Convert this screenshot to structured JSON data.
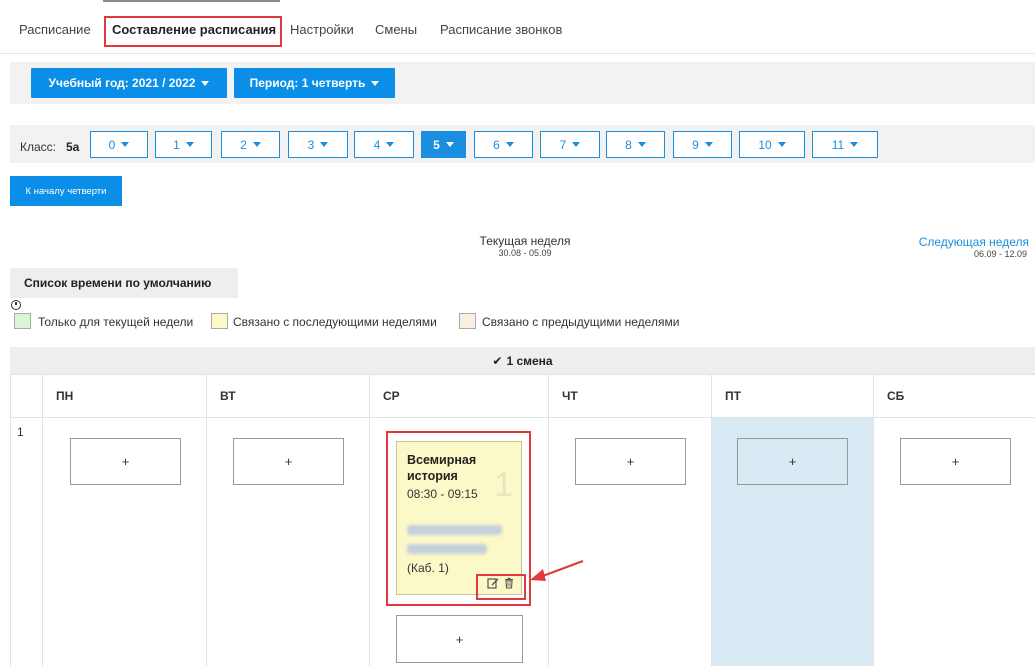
{
  "tabs": [
    {
      "label": "Расписание"
    },
    {
      "label": "Составление расписания",
      "active": true
    },
    {
      "label": "Настройки"
    },
    {
      "label": "Смены"
    },
    {
      "label": "Расписание звонков"
    }
  ],
  "filters": {
    "year_label": "Учебный год: 2021 / 2022",
    "period_label": "Период: 1 четверть"
  },
  "class_selector": {
    "label": "Класс:",
    "current": "5а",
    "grades": [
      "0",
      "1",
      "2",
      "3",
      "4",
      "5",
      "6",
      "7",
      "8",
      "9",
      "10",
      "11"
    ],
    "active_grade": "5"
  },
  "to_quarter_start": "К началу четверти",
  "week": {
    "current_label": "Текущая неделя",
    "current_dates": "30.08 - 05.09",
    "next_label": "Следующая неделя",
    "next_dates": "06.09 - 12.09"
  },
  "default_time_button": "Список времени по умолчанию",
  "legend": [
    {
      "label": "Только для текущей недели",
      "color": "#d9f7d4"
    },
    {
      "label": "Связано с последующими неделями",
      "color": "#fcf9c8"
    },
    {
      "label": "Связано с предыдущими неделями",
      "color": "#fbefe2"
    }
  ],
  "schedule": {
    "shift_label": "1 смена",
    "days": [
      "ПН",
      "ВТ",
      "СР",
      "ЧТ",
      "ПТ",
      "СБ"
    ],
    "row_number": "1",
    "plus": "+",
    "lesson": {
      "title": "Всемирная история",
      "time": "08:30 - 09:15",
      "number": "1",
      "room": "(Каб. 1)"
    }
  },
  "colors": {
    "accent": "#0a8ee8",
    "highlight": "#e0393e",
    "friday_bg": "#d9eaf4"
  }
}
